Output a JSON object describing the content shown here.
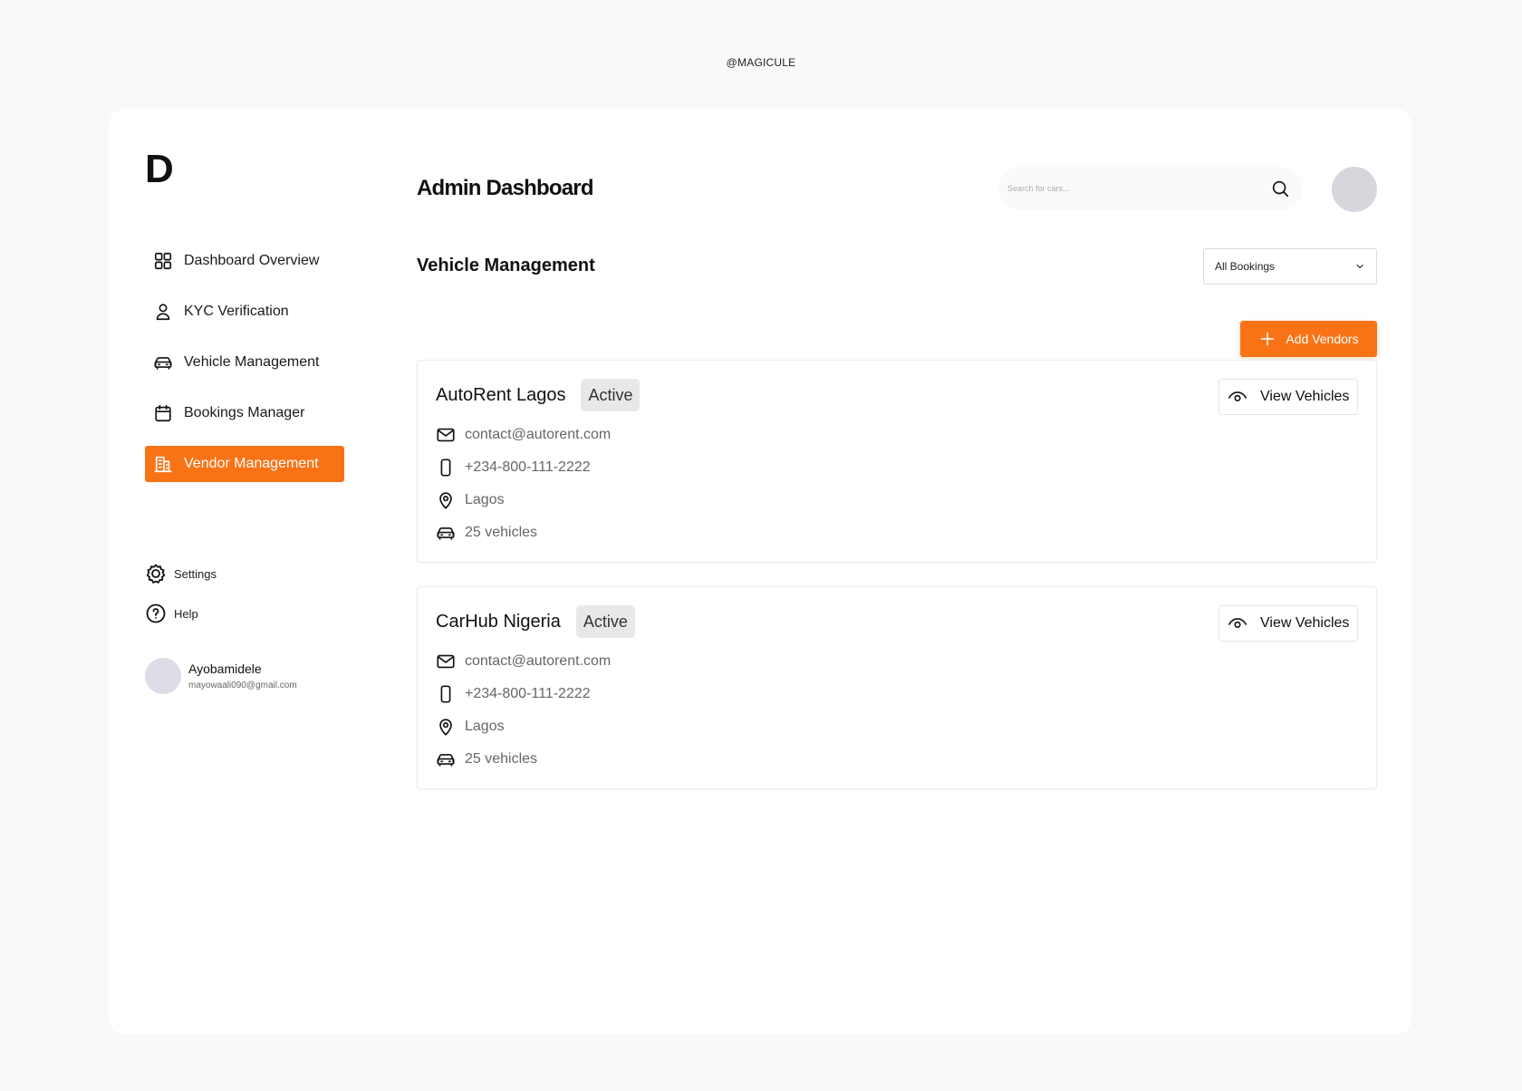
{
  "watermark": "@MAGICULE",
  "sidebar": {
    "logo": "D",
    "items": [
      {
        "label": "Dashboard Overview",
        "icon": "grid-icon"
      },
      {
        "label": "KYC Verification",
        "icon": "user-icon"
      },
      {
        "label": "Vehicle Management",
        "icon": "car-icon"
      },
      {
        "label": "Bookings Manager",
        "icon": "calendar-icon"
      },
      {
        "label": "Vendor Management",
        "icon": "building-icon",
        "active": true
      }
    ],
    "settings_label": "Settings",
    "help_label": "Help",
    "profile": {
      "name": "Ayobamidele",
      "email": "mayowaali090@gmail.com"
    }
  },
  "header": {
    "title": "Admin Dashboard",
    "search_placeholder": "Search for cars..."
  },
  "main": {
    "section_title": "Vehicle Management",
    "filter": {
      "selected": "All Bookings"
    },
    "add_button_label": "Add Vendors",
    "vendors": [
      {
        "name": "AutoRent Lagos",
        "status": "Active",
        "email": "contact@autorent.com",
        "phone": "+234-800-111-2222",
        "location": "Lagos",
        "vehicles": "25 vehicles",
        "view_label": "View Vehicles"
      },
      {
        "name": "CarHub Nigeria",
        "status": "Active",
        "email": "contact@autorent.com",
        "phone": "+234-800-111-2222",
        "location": "Lagos",
        "vehicles": "25 vehicles",
        "view_label": "View Vehicles"
      }
    ]
  },
  "colors": {
    "accent": "#f97316",
    "badge_bg": "#e8e8e8",
    "page_bg": "#f9f9f9"
  }
}
